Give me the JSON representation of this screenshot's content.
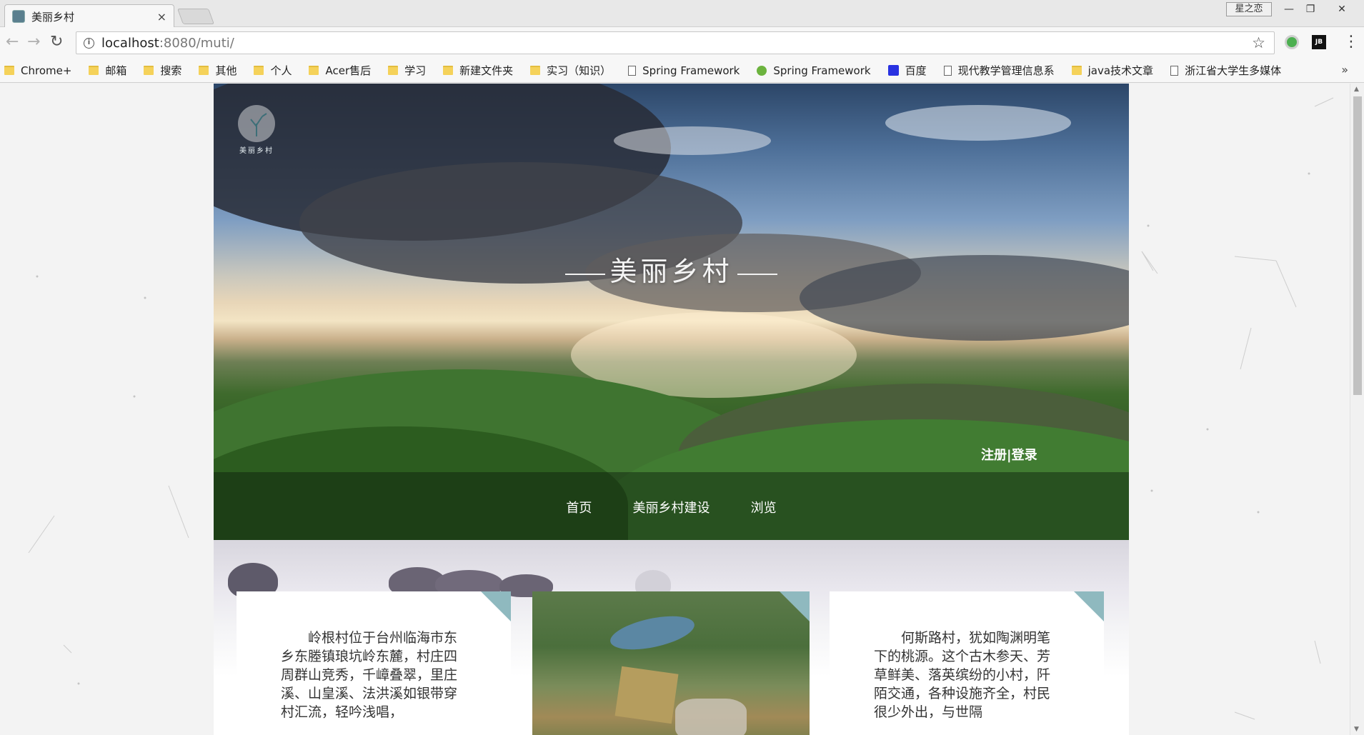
{
  "browser": {
    "tab_title": "美丽乡村",
    "tab_close": "×",
    "user_badge": "星之恋",
    "url_host": "localhost",
    "url_path": ":8080/muti/",
    "ext_jb": "JB",
    "bookmarks": [
      {
        "label": "Chrome+",
        "icon": "folder-icon"
      },
      {
        "label": "邮箱",
        "icon": "folder-icon"
      },
      {
        "label": "搜索",
        "icon": "folder-icon"
      },
      {
        "label": "其他",
        "icon": "folder-icon"
      },
      {
        "label": "个人",
        "icon": "folder-icon"
      },
      {
        "label": "Acer售后",
        "icon": "folder-icon"
      },
      {
        "label": "学习",
        "icon": "folder-icon"
      },
      {
        "label": "新建文件夹",
        "icon": "folder-icon"
      },
      {
        "label": "实习（知识）",
        "icon": "folder-icon"
      },
      {
        "label": "Spring Framework",
        "icon": "page-icon"
      },
      {
        "label": "Spring Framework",
        "icon": "leaf-icon"
      },
      {
        "label": "百度",
        "icon": "paw-icon"
      },
      {
        "label": "现代教学管理信息系",
        "icon": "page-icon"
      },
      {
        "label": "java技术文章",
        "icon": "folder-icon"
      },
      {
        "label": "浙江省大学生多媒体",
        "icon": "page-icon"
      }
    ],
    "bookmarks_more": "»"
  },
  "hero": {
    "logo_text": "美丽乡村",
    "title": "美丽乡村",
    "auth_register": "注册",
    "auth_sep": "|",
    "auth_login": "登录",
    "nav": [
      "首页",
      "美丽乡村建设",
      "浏览"
    ]
  },
  "cards": {
    "left_text": "岭根村位于台州临海市东乡东塍镇琅坑岭东麓，村庄四周群山竞秀，千嶂叠翠，里庄溪、山皇溪、法洪溪如银带穿村汇流，轻吟浅唱，",
    "right_text": "何斯路村，犹如陶渊明笔下的桃源。这个古木参天、芳草鲜美、落英缤纷的小村，阡陌交通，各种设施齐全，村民很少外出，与世隔"
  }
}
